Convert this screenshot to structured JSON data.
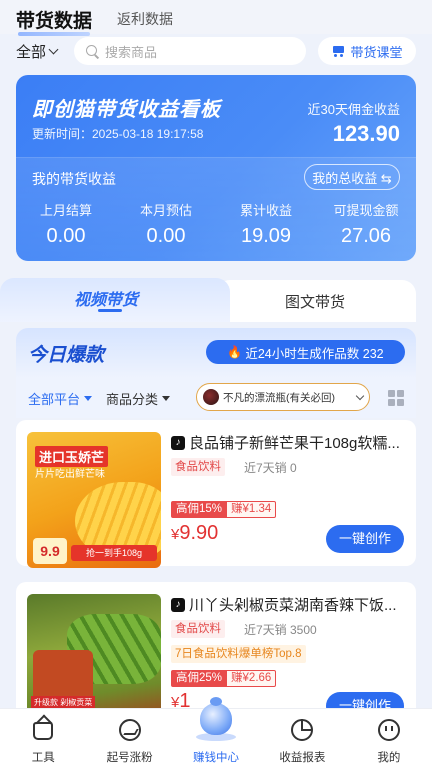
{
  "header": {
    "tabs": [
      "带货数据",
      "返利数据"
    ],
    "filter_all": "全部",
    "search_placeholder": "搜索商品",
    "course_button": "带货课堂"
  },
  "dashboard": {
    "title": "即创猫带货收益看板",
    "update_time": "更新时间：2025-03-18 19:17:58",
    "commission_30d_label": "近30天佣金收益",
    "commission_30d_value": "123.90",
    "my_income_label": "我的带货收益",
    "total_income_button": "我的总收益 ⇆",
    "stats": [
      {
        "label": "上月结算",
        "value": "0.00"
      },
      {
        "label": "本月预估",
        "value": "0.00"
      },
      {
        "label": "累计收益",
        "value": "19.09"
      },
      {
        "label": "可提现金额",
        "value": "27.06"
      }
    ]
  },
  "content_tabs": [
    "视频带货",
    "图文带货"
  ],
  "hot": {
    "title": "今日爆款",
    "badge": "近24小时生成作品数 232",
    "filters": {
      "platform": "全部平台",
      "category": "商品分类",
      "account": "不凡的漂流瓶(有关必回)"
    }
  },
  "products": [
    {
      "title": "良品铺子新鲜芒果干108g软糯...",
      "category": "食品饮料",
      "sales": "近7天销 0",
      "rank": "",
      "commission_rate": "高佣15%",
      "earn": "赚¥1.34",
      "price_symbol": "¥",
      "price": "9.90",
      "button": "一键创作",
      "thumb_text1": "进口玉娇芒",
      "thumb_text2": "片片吃出鲜芒味",
      "thumb_price": "9.9",
      "thumb_band": "抢一到手108g"
    },
    {
      "title": "川丫头剁椒贡菜湖南香辣下饭...",
      "category": "食品饮料",
      "sales": "近7天销 3500",
      "rank": "7日食品饮料爆单榜Top.8",
      "commission_rate": "高佣25%",
      "earn": "赚¥2.66",
      "price_symbol": "¥",
      "price": "1",
      "button": "一键创作",
      "thumb_label": "升级款 剁椒贡菜"
    }
  ],
  "bottom_nav": [
    {
      "label": "工具",
      "icon": "home-icon"
    },
    {
      "label": "起号涨粉",
      "icon": "trend-icon"
    },
    {
      "label": "赚钱中心",
      "icon": "money-bag-icon"
    },
    {
      "label": "收益报表",
      "icon": "pie-chart-icon"
    },
    {
      "label": "我的",
      "icon": "profile-icon"
    }
  ],
  "colors": {
    "accent": "#2c6cf0",
    "price": "#e23232",
    "tag": "#e24a4a"
  }
}
